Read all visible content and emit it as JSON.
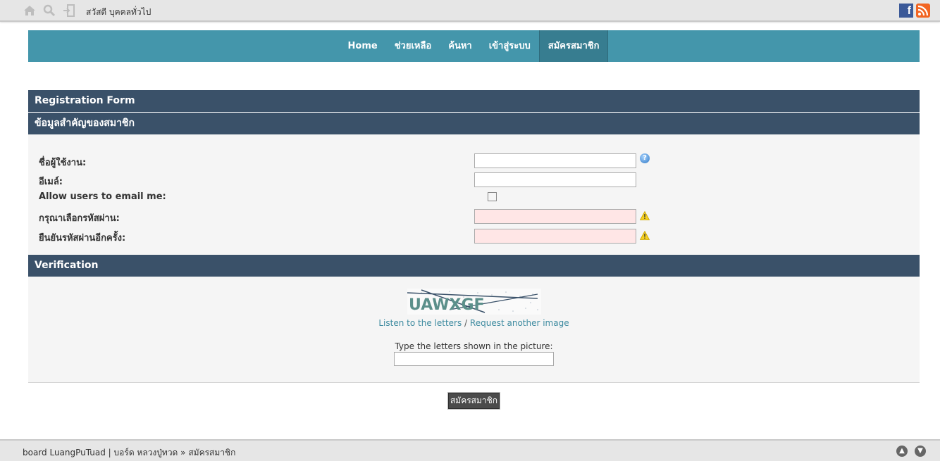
{
  "topbar": {
    "greeting": "สวัสดี บุคคลทั่วไป",
    "icons": [
      "home-icon",
      "search-icon",
      "login-icon"
    ],
    "social": [
      "facebook-icon",
      "rss-icon"
    ]
  },
  "nav": {
    "items": [
      {
        "label": "Home"
      },
      {
        "label": "ช่วยเหลือ"
      },
      {
        "label": "ค้นหา"
      },
      {
        "label": "เข้าสู่ระบบ"
      },
      {
        "label": "สมัครสมาชิก"
      }
    ],
    "active_index": 4,
    "color": "#4496ab"
  },
  "form": {
    "title": "Registration Form",
    "section1": "ข้อมูลสำคัญของสมาชิก",
    "fields": {
      "username_label": "ชื่อผู้ใช้งาน:",
      "email_label": "อีเมล์:",
      "allow_email_label": "Allow users to email me:",
      "password_label": "กรุณาเลือกรหัสผ่าน:",
      "confirm_password_label": "ยืนยันรหัสผ่านอีกครั้ง:",
      "username_value": "",
      "email_value": "",
      "password_value": "",
      "confirm_password_value": ""
    },
    "verification": {
      "title": "Verification",
      "captcha_text": "UAWXGF",
      "listen_link": "Listen to the letters",
      "separator": "/",
      "request_link": "Request another image",
      "type_label": "Type the letters shown in the picture:",
      "input_value": ""
    },
    "submit_label": "สมัครสมาชิก",
    "header_color": "#3a5169"
  },
  "footer": {
    "board": "board LuangPuTuad",
    "sep": "|",
    "board_th": "บอร์ด หลวงปู่ทวด",
    "arrow": "»",
    "current": "สมัครสมาชิก"
  }
}
